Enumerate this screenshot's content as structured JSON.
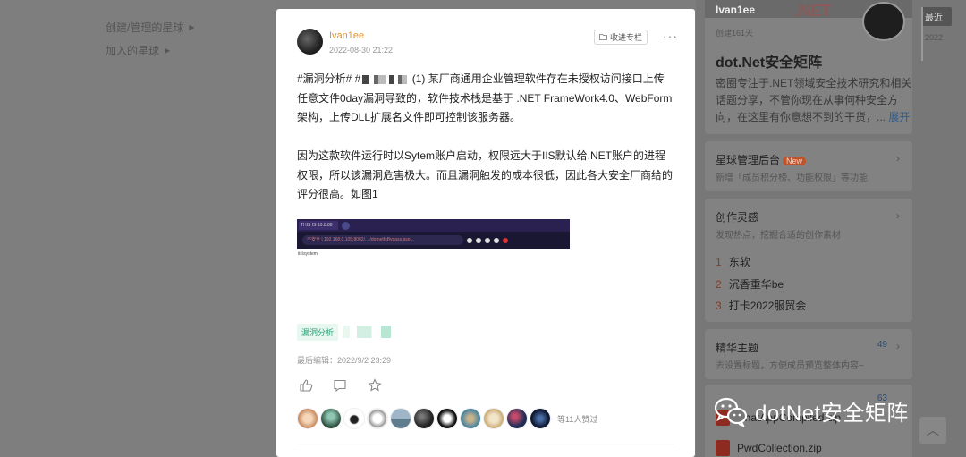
{
  "background_left": {
    "items": [
      "创建/管理的星球",
      "加入的星球"
    ]
  },
  "group_card": {
    "banner_title": "Ivan1ee",
    "banner_net": ".NET",
    "created": "创建161天",
    "name": "dot.Net安全矩阵",
    "desc": "密圈专注于.NET领域安全技术研究和相关话题分享，不管你现在从事何种安全方向，在这里有你意想不到的干货，...",
    "more": "展开"
  },
  "admin_card": {
    "title": "星球管理后台",
    "badge": "New",
    "sub": "新增「成员积分榜、功能权限」等功能"
  },
  "inspire_card": {
    "title": "创作灵感",
    "sub": "发现热点，挖掘合适的创作素材",
    "items": [
      {
        "num": "1",
        "text": "东软"
      },
      {
        "num": "2",
        "text": "沉香重华be"
      },
      {
        "num": "3",
        "text": "打卡2022服贸会"
      }
    ]
  },
  "featured_card": {
    "title": "精华主题",
    "count": "49",
    "sub": "去设置标题，方便成员预览整体内容~"
  },
  "files_card": {
    "count": "63",
    "items": [
      "ChatAppCompiled.zip",
      "PwdCollection.zip"
    ]
  },
  "timeline": {
    "latest": "最近",
    "year": "2022"
  },
  "watermark": {
    "text": "dotNet安全矩阵"
  },
  "post": {
    "author": "Ivan1ee",
    "date": "2022-08-30 21:22",
    "collect_label": "收进专栏",
    "more": "···",
    "para1_prefix": "#漏洞分析# #",
    "para1_text": " (1) 某厂商通用企业管理软件存在未授权访问接口上传任意文件0day漏洞导致的，软件技术栈是基于 .NET FrameWork4.0、WebForm架构，上传DLL扩展名文件即可控制该服务器。",
    "para2": "因为这款软件运行时以Sytem账户启动，权限远大于IIS默认给.NET账户的进程权限，所以该漏洞危害极大。而且漏洞触发的成本很低，因此各大安全厂商给的评分很高。如图1",
    "screenshot": {
      "tab": "THIS IS 10.8.88",
      "url": "不安全 | 192.168.0.105:8082/...   /dotnetfsBypass.asp...",
      "body": "iis\\system"
    },
    "tag": "漏洞分析",
    "edited": "最后编辑：2022/9/2 23:29",
    "likes_text": "等11人赞过"
  }
}
